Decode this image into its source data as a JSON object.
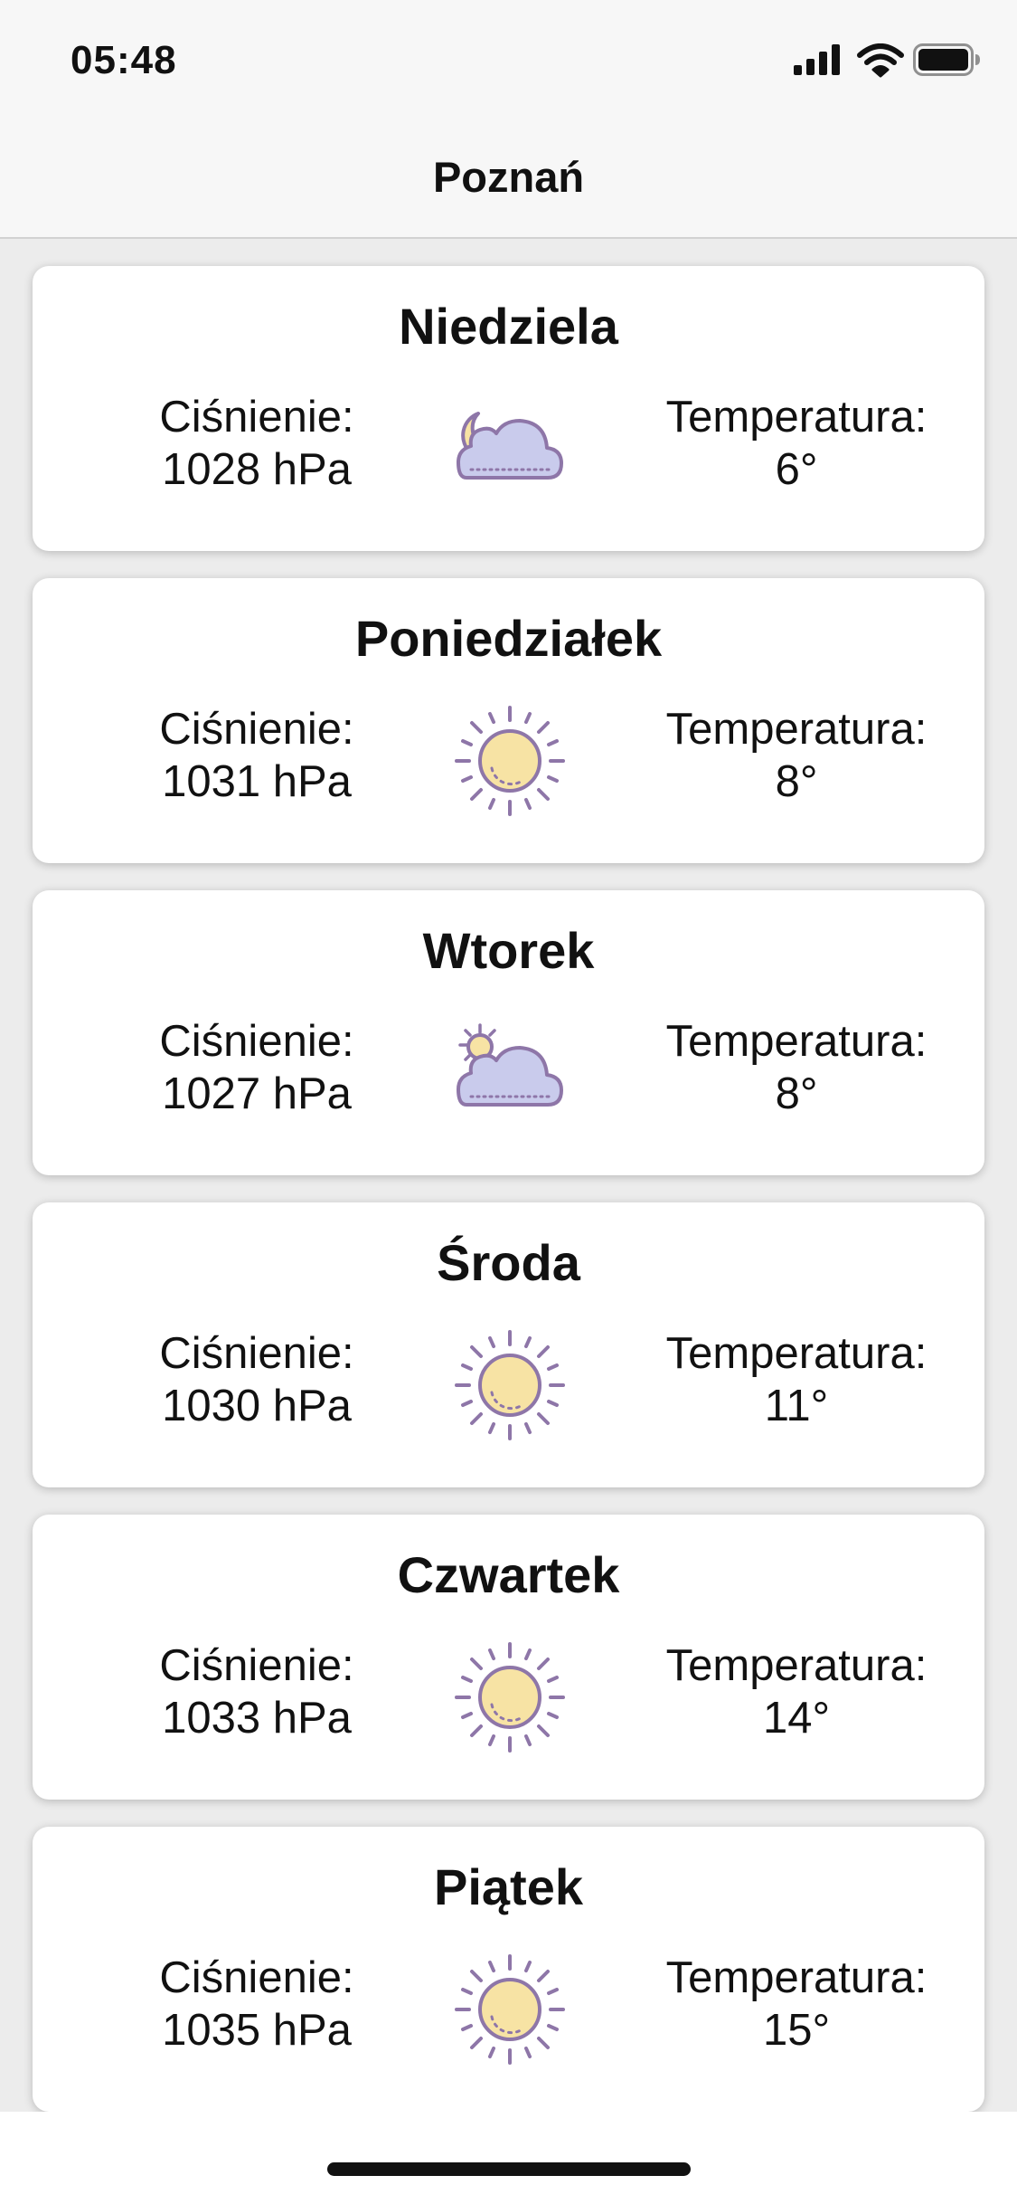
{
  "status_bar": {
    "time": "05:48",
    "icons": [
      "signal-icon",
      "wifi-icon",
      "battery-icon"
    ]
  },
  "nav": {
    "title": "Poznań"
  },
  "colors": {
    "sun": "#f7e3a4",
    "cloud": "#c9cbec",
    "outline": "#8e76a8"
  },
  "forecast": [
    {
      "day": "Niedziela",
      "pressure_label": "Ciśnienie:",
      "pressure": "1028 hPa",
      "temp_label": "Temperatura:",
      "temp": "6°",
      "icon": "moon-cloud-icon"
    },
    {
      "day": "Poniedziałek",
      "pressure_label": "Ciśnienie:",
      "pressure": "1031 hPa",
      "temp_label": "Temperatura:",
      "temp": "8°",
      "icon": "sun-icon"
    },
    {
      "day": "Wtorek",
      "pressure_label": "Ciśnienie:",
      "pressure": "1027 hPa",
      "temp_label": "Temperatura:",
      "temp": "8°",
      "icon": "sun-cloud-icon"
    },
    {
      "day": "Środa",
      "pressure_label": "Ciśnienie:",
      "pressure": "1030 hPa",
      "temp_label": "Temperatura:",
      "temp": "11°",
      "icon": "sun-icon"
    },
    {
      "day": "Czwartek",
      "pressure_label": "Ciśnienie:",
      "pressure": "1033 hPa",
      "temp_label": "Temperatura:",
      "temp": "14°",
      "icon": "sun-icon"
    },
    {
      "day": "Piątek",
      "pressure_label": "Ciśnienie:",
      "pressure": "1035 hPa",
      "temp_label": "Temperatura:",
      "temp": "15°",
      "icon": "sun-icon"
    }
  ]
}
